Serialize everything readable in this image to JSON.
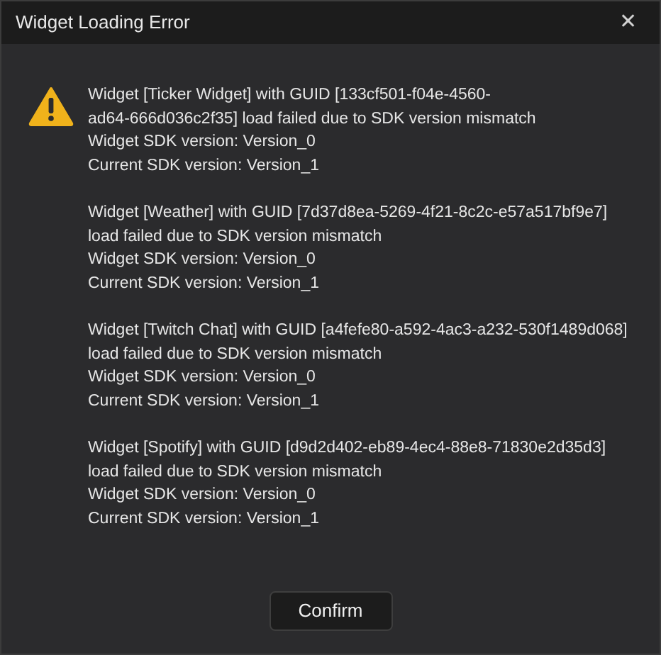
{
  "window": {
    "title": "Widget Loading Error",
    "close": "✕"
  },
  "messages": [
    {
      "lines": [
        "Widget [Ticker Widget] with GUID [133cf501-f04e-4560-",
        "ad64-666d036c2f35] load failed due to SDK version mismatch",
        "Widget SDK version: Version_0",
        "Current SDK version: Version_1"
      ]
    },
    {
      "lines": [
        "Widget [Weather] with GUID [7d37d8ea-5269-4f21-8c2c-e57a517bf9e7]",
        "load failed due to SDK version mismatch",
        "Widget SDK version: Version_0",
        "Current SDK version: Version_1"
      ]
    },
    {
      "lines": [
        "Widget [Twitch Chat] with GUID [a4fefe80-a592-4ac3-a232-530f1489d068]",
        "load failed due to SDK version mismatch",
        "Widget SDK version: Version_0",
        "Current SDK version: Version_1"
      ]
    },
    {
      "lines": [
        "Widget [Spotify] with GUID [d9d2d402-eb89-4ec4-88e8-71830e2d35d3]",
        "load failed due to SDK version mismatch",
        "Widget SDK version: Version_0",
        "Current SDK version: Version_1"
      ]
    }
  ],
  "buttons": [
    {
      "label": "Confirm"
    }
  ]
}
